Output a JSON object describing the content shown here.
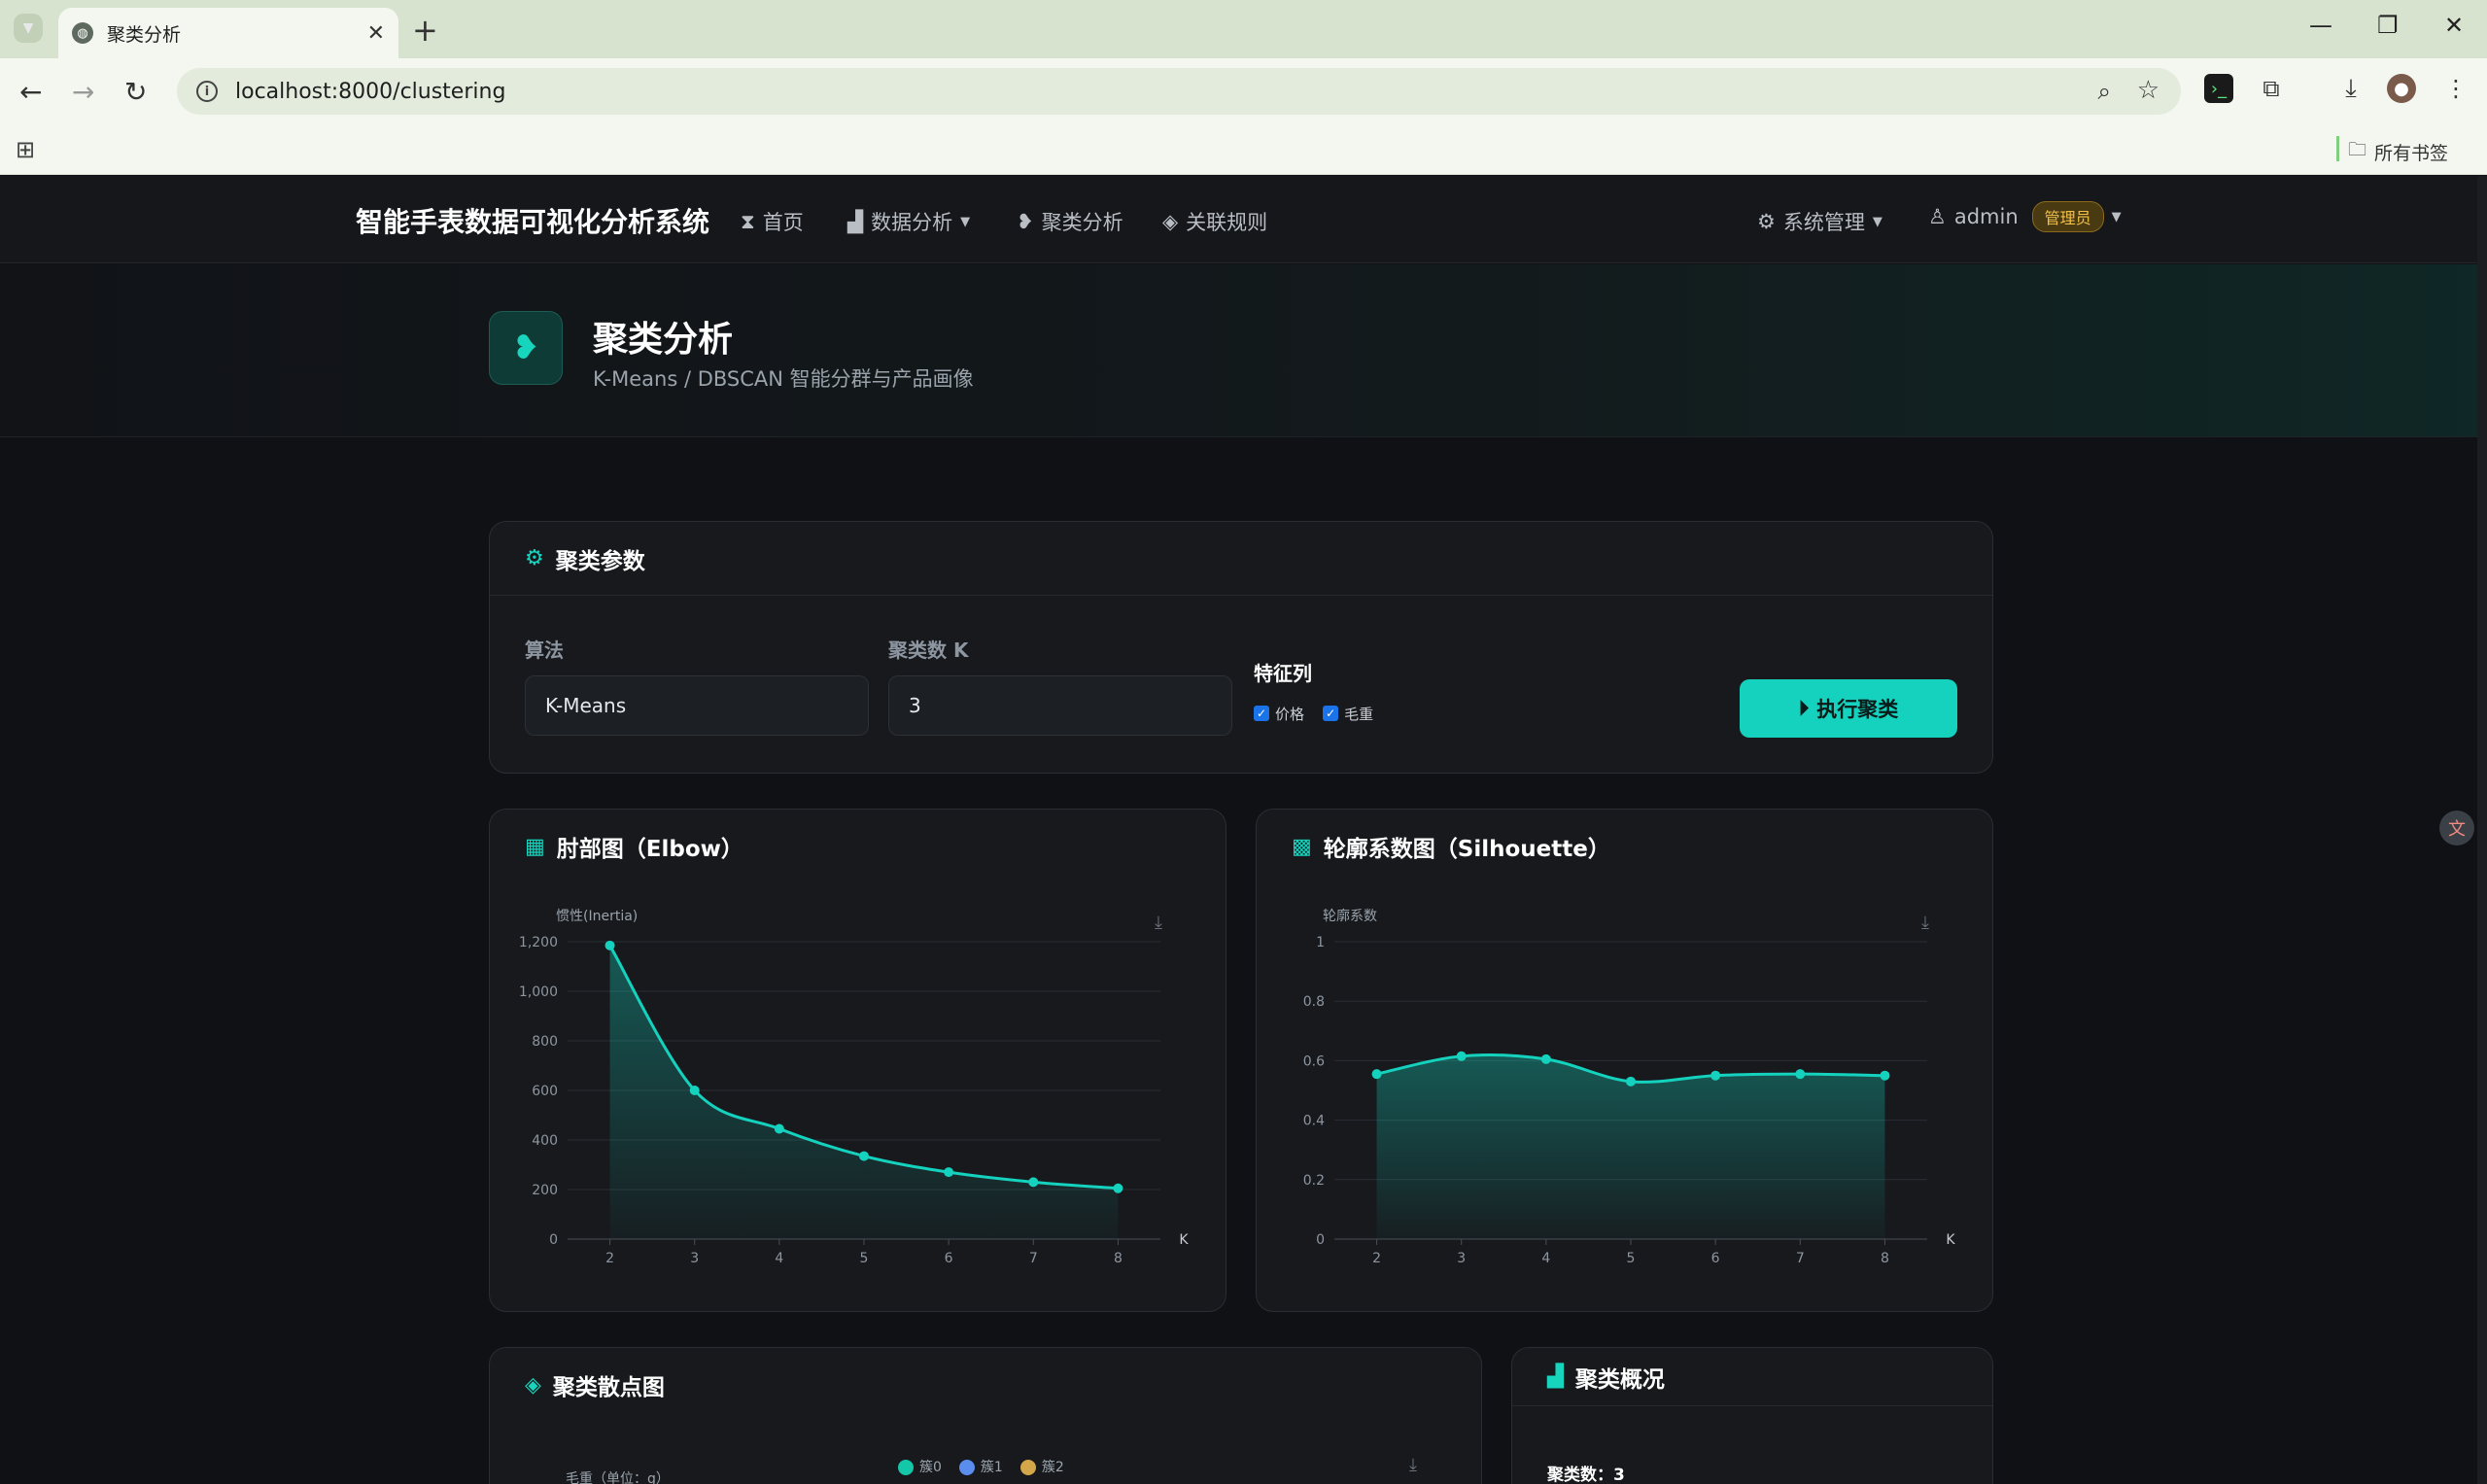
{
  "browser": {
    "tab_title": "聚类分析",
    "url": "localhost:8000/clustering",
    "bookmarks_folder": "所有书签"
  },
  "navbar": {
    "brand": "智能手表数据可视化分析系统",
    "items": [
      {
        "label": "首页",
        "icon": "hourglass-icon"
      },
      {
        "label": "数据分析",
        "icon": "bar-chart-icon",
        "dropdown": true
      },
      {
        "label": "聚类分析",
        "icon": "thumbs-down-icon"
      },
      {
        "label": "关联规则",
        "icon": "gamepad-icon"
      }
    ],
    "system_label": "系统管理",
    "user_label": "admin",
    "role_badge": "管理员"
  },
  "header": {
    "title": "聚类分析",
    "subtitle": "K-Means / DBSCAN 智能分群与产品画像"
  },
  "params": {
    "title": "聚类参数",
    "algo_label": "算法",
    "algo_value": "K-Means",
    "k_label": "聚类数 K",
    "k_value": "3",
    "features_label": "特征列",
    "features": [
      "价格",
      "毛重"
    ],
    "run_label": "执行聚类"
  },
  "colors": {
    "accent": "#14d2bd",
    "cluster0": "#14c7a8",
    "cluster1": "#5b8def",
    "cluster2": "#d4a64a"
  },
  "chart_data": [
    {
      "type": "area",
      "title": "肘部图（Elbow）",
      "ylabel": "惯性(Inertia)",
      "xlabel": "K",
      "x": [
        2,
        3,
        4,
        5,
        6,
        7,
        8
      ],
      "values": [
        1185,
        600,
        445,
        335,
        270,
        230,
        205
      ],
      "ylim": [
        0,
        1200
      ],
      "yticks": [
        0,
        200,
        400,
        600,
        800,
        1000,
        1200
      ],
      "ytick_labels": [
        "0",
        "200",
        "400",
        "600",
        "800",
        "1,000",
        "1,200"
      ]
    },
    {
      "type": "area",
      "title": "轮廓系数图（Silhouette）",
      "ylabel": "轮廓系数",
      "xlabel": "K",
      "x": [
        2,
        3,
        4,
        5,
        6,
        7,
        8
      ],
      "values": [
        0.555,
        0.615,
        0.605,
        0.53,
        0.55,
        0.555,
        0.55
      ],
      "ylim": [
        0,
        1
      ],
      "yticks": [
        0,
        0.2,
        0.4,
        0.6,
        0.8,
        1
      ],
      "ytick_labels": [
        "0",
        "0.2",
        "0.4",
        "0.6",
        "0.8",
        "1"
      ]
    }
  ],
  "scatter": {
    "title": "聚类散点图",
    "ylabel": "毛重（单位：g）",
    "legend": [
      "簇0",
      "簇1",
      "簇2"
    ]
  },
  "summary": {
    "title": "聚类概况",
    "count_label": "聚类数：",
    "count_value": "3"
  }
}
